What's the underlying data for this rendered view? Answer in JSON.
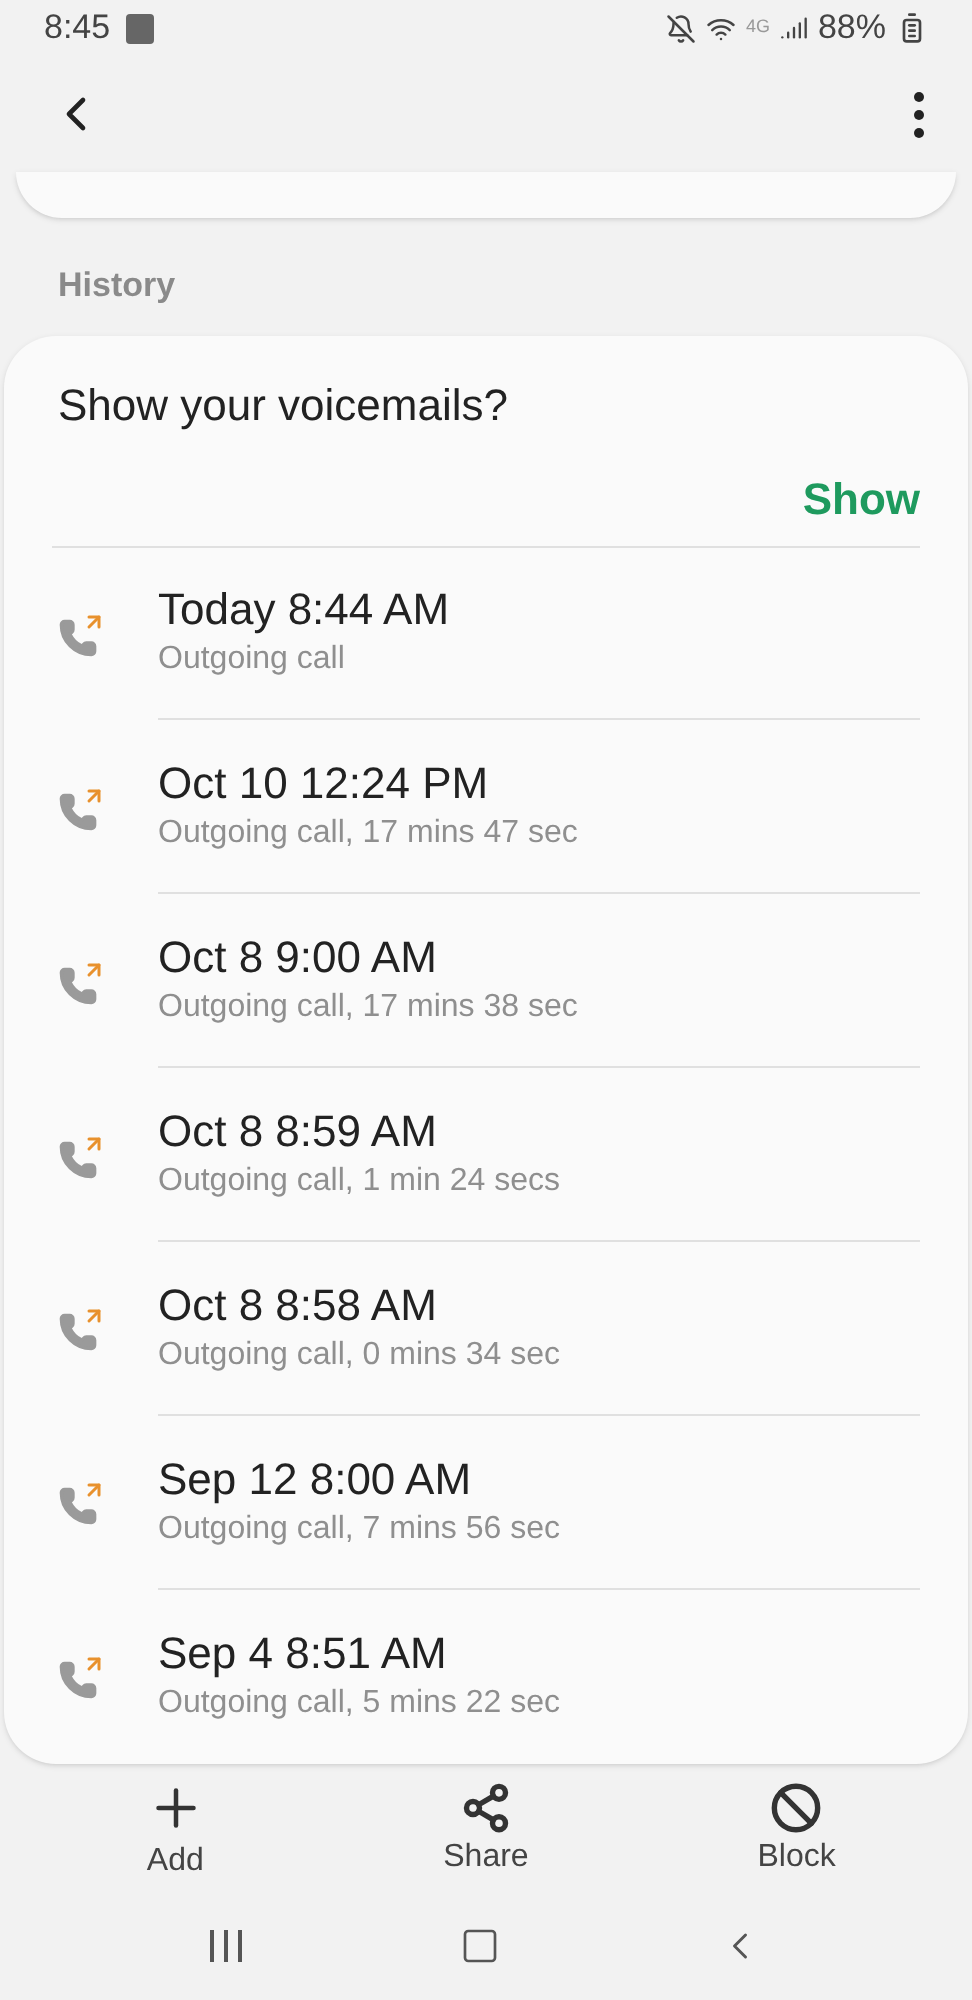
{
  "status_bar": {
    "time": "8:45",
    "network": "4G",
    "battery": "88%"
  },
  "section_title": "History",
  "voicemail_prompt": {
    "question": "Show your voicemails?",
    "action": "Show"
  },
  "calls": [
    {
      "kind": "outgoing",
      "time": "Today 8:44 AM",
      "detail": "Outgoing call"
    },
    {
      "kind": "outgoing",
      "time": "Oct 10 12:24 PM",
      "detail": "Outgoing call, 17 mins 47 sec"
    },
    {
      "kind": "outgoing",
      "time": "Oct 8 9:00 AM",
      "detail": "Outgoing call, 17 mins 38 sec"
    },
    {
      "kind": "outgoing",
      "time": "Oct 8 8:59 AM",
      "detail": "Outgoing call, 1 min 24 secs"
    },
    {
      "kind": "outgoing",
      "time": "Oct 8 8:58 AM",
      "detail": "Outgoing call, 0 mins 34 sec"
    },
    {
      "kind": "outgoing",
      "time": "Sep 12 8:00 AM",
      "detail": "Outgoing call, 7 mins 56 sec"
    },
    {
      "kind": "outgoing",
      "time": "Sep 4 8:51 AM",
      "detail": "Outgoing call, 5 mins 22 sec"
    }
  ],
  "actions": [
    {
      "kind": "add",
      "label": "Add"
    },
    {
      "kind": "share",
      "label": "Share"
    },
    {
      "kind": "block",
      "label": "Block"
    }
  ]
}
